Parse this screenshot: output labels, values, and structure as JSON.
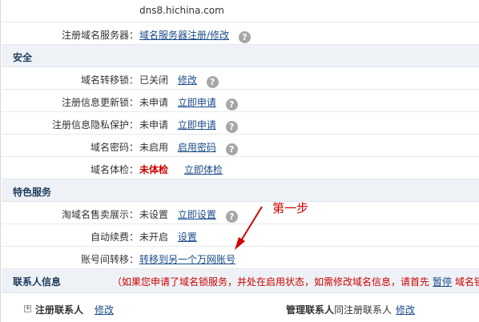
{
  "top_value": "dns8.hichina.com",
  "rows": {
    "dns_server": {
      "label": "注册域名服务器：",
      "link": "域名服务器注册/修改"
    },
    "transfer_lock": {
      "label": "域名转移锁：",
      "status": "已关闭",
      "link": "修改"
    },
    "update_lock": {
      "label": "注册信息更新锁：",
      "status": "未申请",
      "link": "立即申请"
    },
    "privacy": {
      "label": "注册信息隐私保护：",
      "status": "未申请",
      "link": "立即申请"
    },
    "password": {
      "label": "域名密码：",
      "status": "未启用",
      "link": "启用密码"
    },
    "health": {
      "label": "域名体检：",
      "status": "未体检",
      "link": "立即体检"
    },
    "sale": {
      "label": "淘域名售卖展示：",
      "status": "未设置",
      "link": "立即设置"
    },
    "renew": {
      "label": "自动续费：",
      "status": "未开启",
      "link": "设置"
    },
    "account_transfer": {
      "label": "账号间转移：",
      "link": "转移到另一个万网账号"
    }
  },
  "sections": {
    "security": "安全",
    "special": "特色服务",
    "contact": "联系人信息"
  },
  "contact_note_prefix": "（如果您申请了域名锁服务，并处在启用状态，如需修改域名信息，请首先",
  "contact_note_link": "暂停",
  "contact_note_suffix": "域名锁",
  "help_glyph": "?",
  "annotation": "第一步",
  "bottom": {
    "expand_glyph": "+",
    "registrant_label": "注册联系人",
    "registrant_edit": "修改",
    "admin_label": "管理联系人",
    "admin_text": "同注册联系人",
    "admin_edit": "修改"
  },
  "colors": {
    "link": "#1a4a8a",
    "alert": "#cc0000",
    "section_bg": "#eef2f6",
    "annotation": "#d00000"
  }
}
